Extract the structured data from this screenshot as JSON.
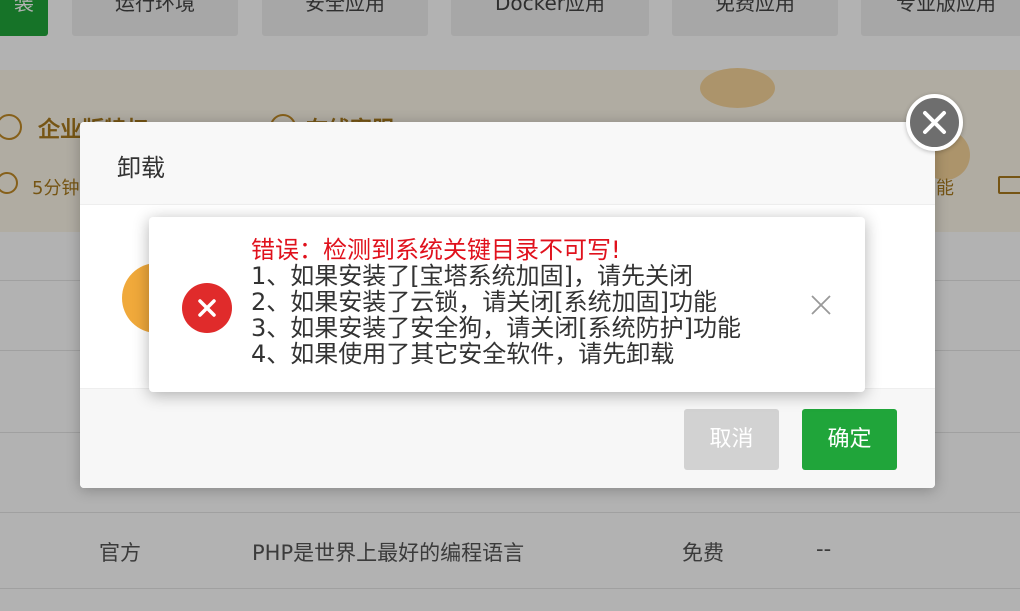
{
  "tabs": {
    "first": "装",
    "runtime": "运行环境",
    "security": "安全应用",
    "docker": "Docker应用",
    "free": "免费应用",
    "pro": "专业版应用"
  },
  "promo": {
    "enterprise": "企业版特权",
    "online_service": "在线客服",
    "response_time": "5分钟",
    "feature_suffix": "能"
  },
  "table_row": {
    "source": "官方",
    "description": "PHP是世界上最好的编程语言",
    "price": "免费",
    "extra": "--"
  },
  "dialog": {
    "title": "卸载",
    "cancel_label": "取消",
    "confirm_label": "确定"
  },
  "toast": {
    "title": "错误：检测到系统关键目录不可写!",
    "lines": [
      "1、如果安装了[宝塔系统加固]，请先关闭",
      "2、如果安装了云锁，请关闭[系统加固]功能",
      "3、如果安装了安全狗，请关闭[系统防护]功能",
      "4、如果使用了其它安全软件，请先卸载"
    ]
  },
  "colors": {
    "brand_green": "#20a53a",
    "error_red": "#e02b2b",
    "promo_gold": "#a97a1e"
  }
}
